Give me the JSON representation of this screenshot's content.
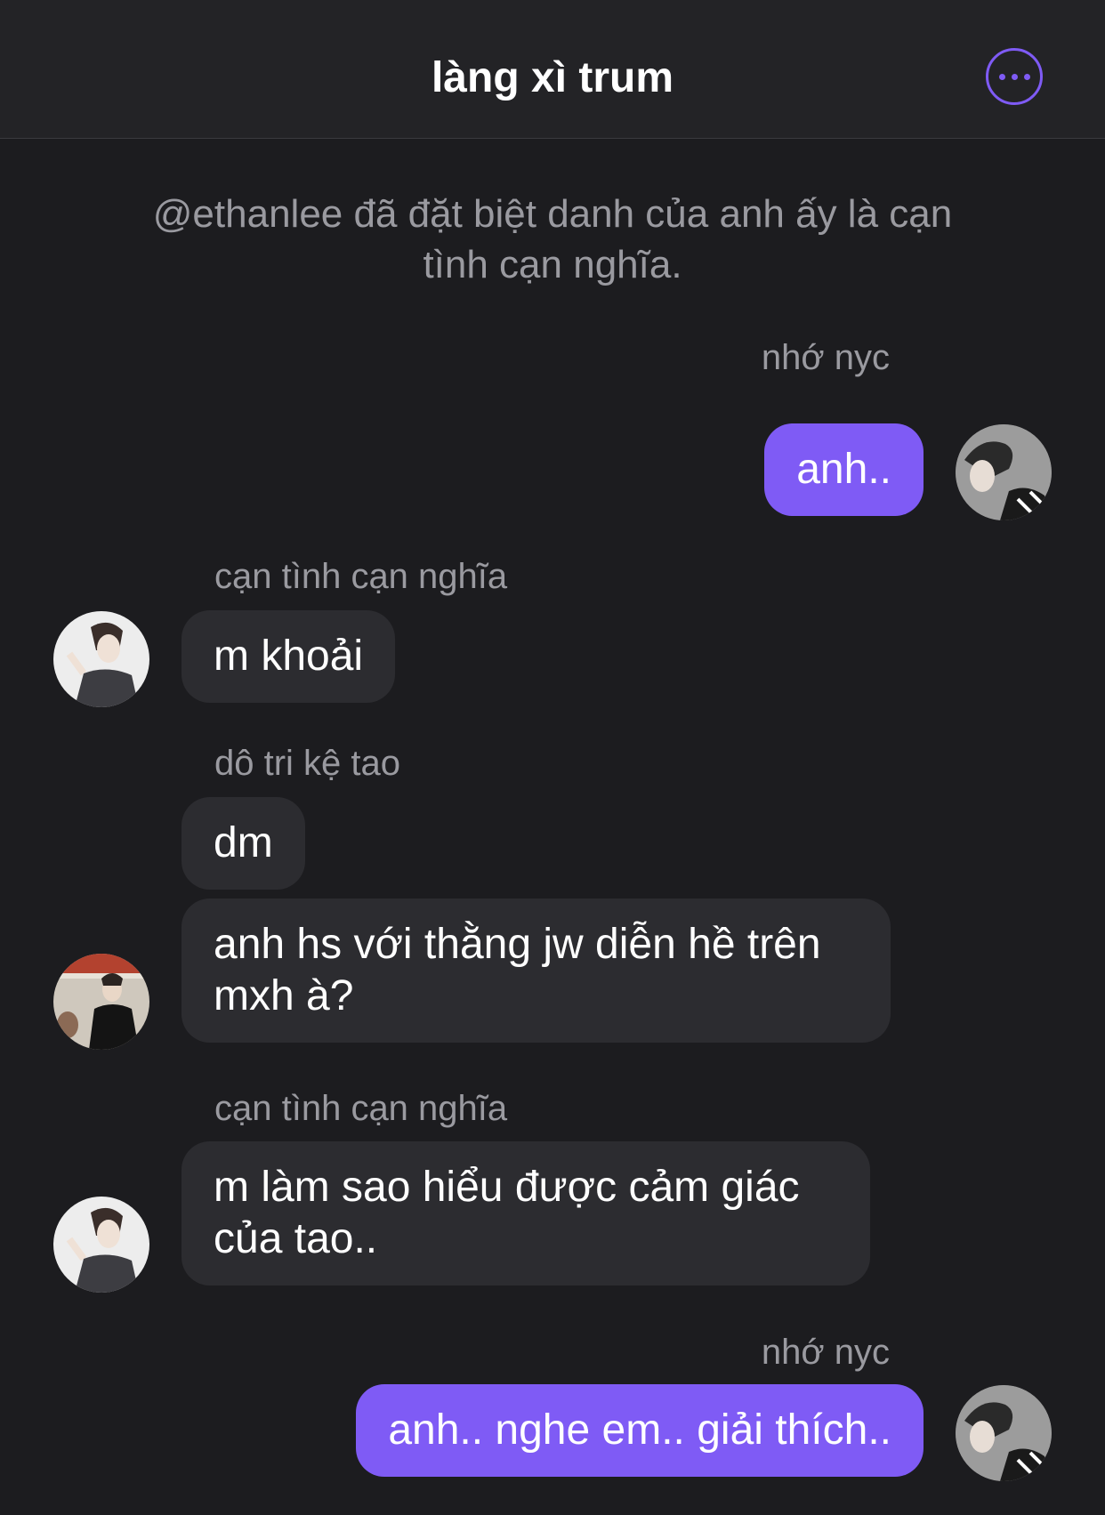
{
  "header": {
    "title": "làng xì trum",
    "more_icon": "more-horizontal-icon",
    "accent": "#7f5bf5"
  },
  "system_message": "@ethanlee đã đặt biệt danh của anh ấy là cạn tình cạn nghĩa.",
  "messages": [
    {
      "sender": "nhớ nyc",
      "text": "anh..",
      "direction": "outgoing"
    },
    {
      "sender": "cạn tình cạn nghĩa",
      "text": "m khoải",
      "direction": "incoming"
    },
    {
      "sender": "dô tri kệ tao",
      "text": "dm",
      "direction": "incoming"
    },
    {
      "sender": "",
      "text": "anh hs với thằng jw diễn hề trên mxh à?",
      "direction": "incoming"
    },
    {
      "sender": "cạn tình cạn nghĩa",
      "text": "m làm sao hiểu được cảm giác của tao..",
      "direction": "incoming"
    },
    {
      "sender": "nhớ nyc",
      "text": "anh.. nghe em.. giải thích..",
      "direction": "outgoing"
    }
  ],
  "colors": {
    "background": "#1c1c1f",
    "header_bg": "#232326",
    "incoming_bubble": "#2c2c30",
    "outgoing_bubble": "#7f5bf5",
    "meta_text": "#9a9aa0"
  }
}
